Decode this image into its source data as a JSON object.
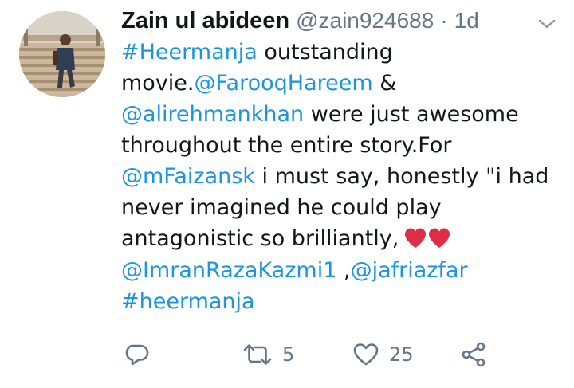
{
  "tweet": {
    "author": {
      "display_name": "Zain ul abideen",
      "handle": "@zain924688",
      "avatar_icon": "profile-photo"
    },
    "separator": "·",
    "timestamp": "1d",
    "menu_icon": "chevron-down-icon",
    "text": {
      "l1_tag": "#Heermanja",
      "l1_rest": " outstanding",
      "l2_text": "movie.",
      "l2_mention": "@FarooqHareem",
      "l2_rest": " &",
      "l3_mention": "@alirehmankhan",
      "l3_rest": " were just awesome",
      "l4_text": "throughout the entire story.For",
      "l5_mention": "@mFaizansk",
      "l5_rest": " i must say, honestly \"i had",
      "l6_text": "never imagined he could play",
      "l7_text": "antagonistic so brilliantly,",
      "l7_emoji": "❤❤",
      "l8_mention1": "@ImranRazaKazmi1",
      "l8_sep": " ,",
      "l8_mention2": "@jafriazfar",
      "l9_tag": "#heermanja"
    },
    "actions": {
      "reply": {
        "icon": "reply-icon",
        "count": ""
      },
      "retweet": {
        "icon": "retweet-icon",
        "count": "5"
      },
      "like": {
        "icon": "heart-icon",
        "count": "25"
      },
      "share": {
        "icon": "share-icon",
        "count": ""
      }
    },
    "colors": {
      "link": "#1b95e0",
      "muted": "#657786",
      "text": "#14171a",
      "heart_emoji": "#dd2e44"
    }
  }
}
